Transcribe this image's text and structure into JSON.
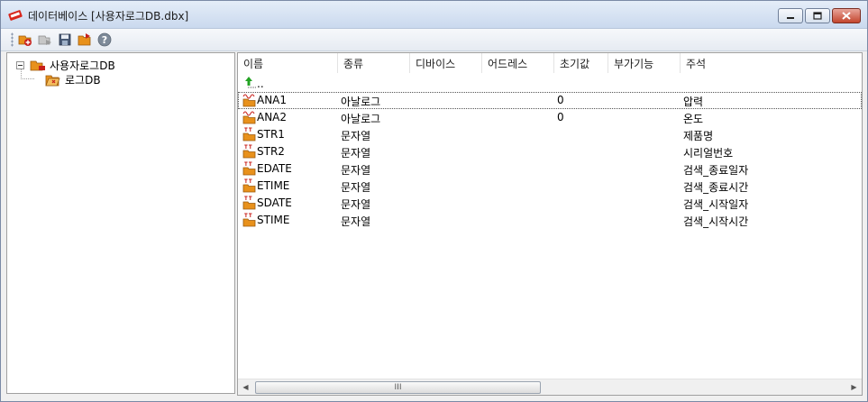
{
  "window": {
    "title": "데이터베이스 [사용자로그DB.dbx]"
  },
  "toolbar": {
    "buttons": [
      "add-icon",
      "send-icon",
      "save-icon",
      "open-icon",
      "help-icon"
    ]
  },
  "tree": {
    "root_label": "사용자로그DB",
    "child_label": "로그DB"
  },
  "list": {
    "columns": [
      "이름",
      "종류",
      "디바이스",
      "어드레스",
      "초기값",
      "부가기능",
      "주석"
    ],
    "parent_label": "..",
    "rows": [
      {
        "name": "ANA1",
        "type": "아날로그",
        "device": "",
        "address": "",
        "initial": "0",
        "extra": "",
        "comment": "압력"
      },
      {
        "name": "ANA2",
        "type": "아날로그",
        "device": "",
        "address": "",
        "initial": "0",
        "extra": "",
        "comment": "온도"
      },
      {
        "name": "STR1",
        "type": "문자열",
        "device": "",
        "address": "",
        "initial": "",
        "extra": "",
        "comment": "제품명"
      },
      {
        "name": "STR2",
        "type": "문자열",
        "device": "",
        "address": "",
        "initial": "",
        "extra": "",
        "comment": "시리얼번호"
      },
      {
        "name": "EDATE",
        "type": "문자열",
        "device": "",
        "address": "",
        "initial": "",
        "extra": "",
        "comment": "검색_종료일자"
      },
      {
        "name": "ETIME",
        "type": "문자열",
        "device": "",
        "address": "",
        "initial": "",
        "extra": "",
        "comment": "검색_종료시간"
      },
      {
        "name": "SDATE",
        "type": "문자열",
        "device": "",
        "address": "",
        "initial": "",
        "extra": "",
        "comment": "검색_시작일자"
      },
      {
        "name": "STIME",
        "type": "문자열",
        "device": "",
        "address": "",
        "initial": "",
        "extra": "",
        "comment": "검색_시작시간"
      }
    ],
    "row_icons": [
      "analog-tag-icon",
      "analog-tag-icon",
      "string-tag-icon",
      "string-tag-icon",
      "string-tag-icon",
      "string-tag-icon",
      "string-tag-icon",
      "string-tag-icon"
    ]
  },
  "scrollbar": {
    "thumb_label": "III"
  },
  "colors": {
    "selection_dots": "#555555",
    "tag_icon_orange": "#e8911c",
    "tag_icon_red": "#c8201c",
    "up_arrow_green": "#23a323"
  }
}
